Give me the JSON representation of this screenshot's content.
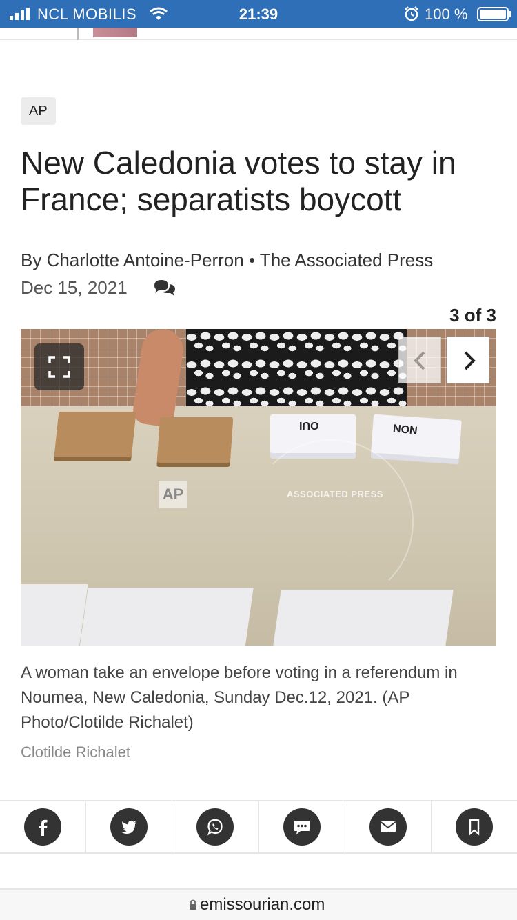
{
  "status_bar": {
    "carrier": "NCL MOBILIS",
    "time": "21:39",
    "battery": "100 %"
  },
  "article": {
    "source_badge": "AP",
    "headline": "New Caledonia votes to stay in France; separatists boycott",
    "byline": "By Charlotte Antoine-Perron • The Associated Press",
    "date": "Dec 15, 2021"
  },
  "gallery": {
    "counter": "3 of 3",
    "photo_watermark": "AP",
    "photo_watermark_text": "ASSOCIATED PRESS",
    "card_labels": [
      "OUI",
      "NON"
    ],
    "caption": "A woman take an envelope before voting in a referendum in Noumea, New Caledonia, Sunday Dec.12, 2021.  (AP Photo/Clotilde Richalet)",
    "credit": "Clotilde Richalet"
  },
  "share_bar": {
    "icons": [
      "facebook-icon",
      "twitter-icon",
      "whatsapp-icon",
      "sms-icon",
      "email-icon",
      "bookmark-icon"
    ]
  },
  "browser": {
    "url": "emissourian.com"
  }
}
